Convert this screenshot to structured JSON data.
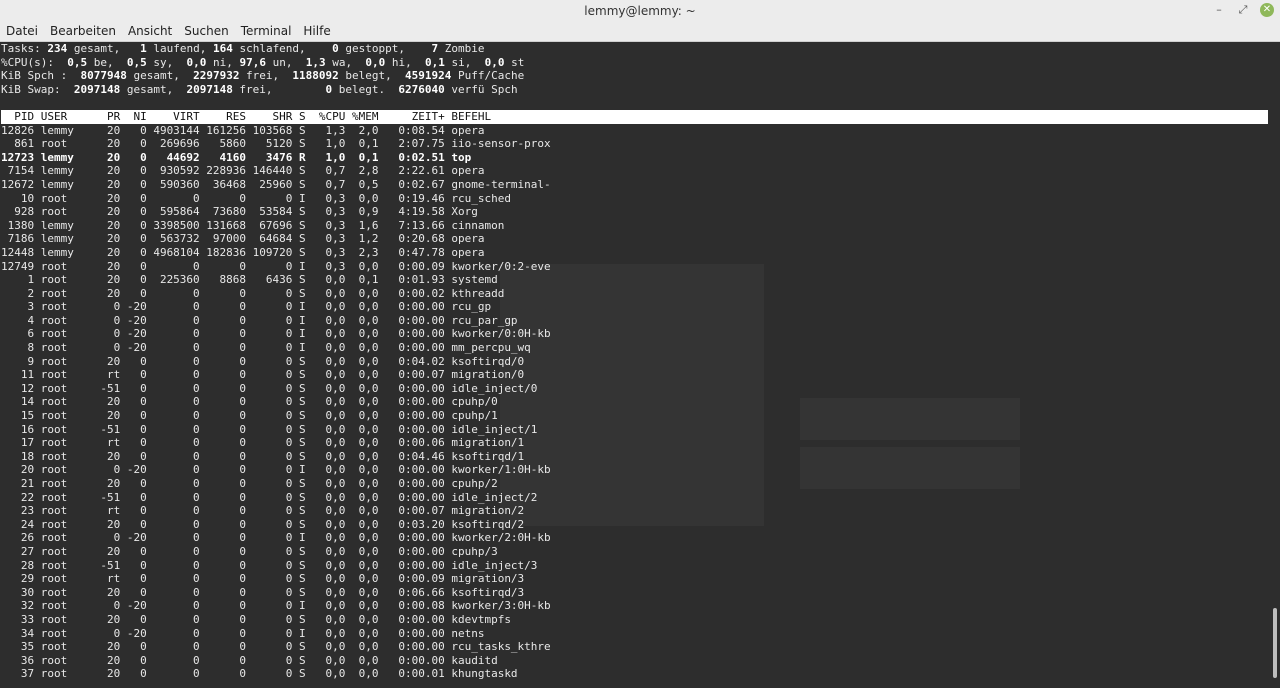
{
  "window": {
    "title": "lemmy@lemmy: ~",
    "controls": [
      "–",
      "⤢",
      "✕"
    ]
  },
  "menu": [
    "Datei",
    "Bearbeiten",
    "Ansicht",
    "Suchen",
    "Terminal",
    "Hilfe"
  ],
  "summary": {
    "tasks": {
      "label": "Tasks:",
      "total": "234",
      "total_label": "gesamt,",
      "running": "1",
      "running_label": "laufend,",
      "sleeping": "164",
      "sleeping_label": "schlafend,",
      "stopped": "0",
      "stopped_label": "gestoppt,",
      "zombie": "7",
      "zombie_label": "Zombie"
    },
    "cpu": {
      "label": "%CPU(s):",
      "be": "0,5",
      "sy": "0,5",
      "ni": "0,0",
      "un": "97,6",
      "wa": "1,3",
      "hi": "0,0",
      "si": "0,1",
      "st": "0,0"
    },
    "mem": {
      "label": "KiB Spch :",
      "total": "8077948",
      "free": "2297932",
      "used": "1188092",
      "cache": "4591924",
      "cache_label": "Puff/Cache"
    },
    "swap": {
      "label": "KiB Swap:",
      "total": "2097148",
      "free": "2097148",
      "used": "0",
      "avail": "6276040",
      "avail_label": "verfü Spch"
    }
  },
  "columns": [
    "PID",
    "USER",
    "PR",
    "NI",
    "VIRT",
    "RES",
    "SHR",
    "S",
    "%CPU",
    "%MEM",
    "ZEIT+",
    "BEFEHL"
  ],
  "processes": [
    [
      "12826",
      "lemmy",
      "20",
      "0",
      "4903144",
      "161256",
      "103568",
      "S",
      "1,3",
      "2,0",
      "0:08.54",
      "opera"
    ],
    [
      "861",
      "root",
      "20",
      "0",
      "269696",
      "5860",
      "5120",
      "S",
      "1,0",
      "0,1",
      "2:07.75",
      "iio-sensor-prox"
    ],
    [
      "12723",
      "lemmy",
      "20",
      "0",
      "44692",
      "4160",
      "3476",
      "R",
      "1,0",
      "0,1",
      "0:02.51",
      "top"
    ],
    [
      "7154",
      "lemmy",
      "20",
      "0",
      "930592",
      "228936",
      "146440",
      "S",
      "0,7",
      "2,8",
      "2:22.61",
      "opera"
    ],
    [
      "12672",
      "lemmy",
      "20",
      "0",
      "590360",
      "36468",
      "25960",
      "S",
      "0,7",
      "0,5",
      "0:02.67",
      "gnome-terminal-"
    ],
    [
      "10",
      "root",
      "20",
      "0",
      "0",
      "0",
      "0",
      "I",
      "0,3",
      "0,0",
      "0:19.46",
      "rcu_sched"
    ],
    [
      "928",
      "root",
      "20",
      "0",
      "595864",
      "73680",
      "53584",
      "S",
      "0,3",
      "0,9",
      "4:19.58",
      "Xorg"
    ],
    [
      "1380",
      "lemmy",
      "20",
      "0",
      "3398500",
      "131668",
      "67696",
      "S",
      "0,3",
      "1,6",
      "7:13.66",
      "cinnamon"
    ],
    [
      "7186",
      "lemmy",
      "20",
      "0",
      "563732",
      "97000",
      "64684",
      "S",
      "0,3",
      "1,2",
      "0:20.68",
      "opera"
    ],
    [
      "12448",
      "lemmy",
      "20",
      "0",
      "4968104",
      "182836",
      "109720",
      "S",
      "0,3",
      "2,3",
      "0:47.78",
      "opera"
    ],
    [
      "12749",
      "root",
      "20",
      "0",
      "0",
      "0",
      "0",
      "I",
      "0,3",
      "0,0",
      "0:00.09",
      "kworker/0:2-eve"
    ],
    [
      "1",
      "root",
      "20",
      "0",
      "225360",
      "8868",
      "6436",
      "S",
      "0,0",
      "0,1",
      "0:01.93",
      "systemd"
    ],
    [
      "2",
      "root",
      "20",
      "0",
      "0",
      "0",
      "0",
      "S",
      "0,0",
      "0,0",
      "0:00.02",
      "kthreadd"
    ],
    [
      "3",
      "root",
      "0",
      "-20",
      "0",
      "0",
      "0",
      "I",
      "0,0",
      "0,0",
      "0:00.00",
      "rcu_gp"
    ],
    [
      "4",
      "root",
      "0",
      "-20",
      "0",
      "0",
      "0",
      "I",
      "0,0",
      "0,0",
      "0:00.00",
      "rcu_par_gp"
    ],
    [
      "6",
      "root",
      "0",
      "-20",
      "0",
      "0",
      "0",
      "I",
      "0,0",
      "0,0",
      "0:00.00",
      "kworker/0:0H-kb"
    ],
    [
      "8",
      "root",
      "0",
      "-20",
      "0",
      "0",
      "0",
      "I",
      "0,0",
      "0,0",
      "0:00.00",
      "mm_percpu_wq"
    ],
    [
      "9",
      "root",
      "20",
      "0",
      "0",
      "0",
      "0",
      "S",
      "0,0",
      "0,0",
      "0:04.02",
      "ksoftirqd/0"
    ],
    [
      "11",
      "root",
      "rt",
      "0",
      "0",
      "0",
      "0",
      "S",
      "0,0",
      "0,0",
      "0:00.07",
      "migration/0"
    ],
    [
      "12",
      "root",
      "-51",
      "0",
      "0",
      "0",
      "0",
      "S",
      "0,0",
      "0,0",
      "0:00.00",
      "idle_inject/0"
    ],
    [
      "14",
      "root",
      "20",
      "0",
      "0",
      "0",
      "0",
      "S",
      "0,0",
      "0,0",
      "0:00.00",
      "cpuhp/0"
    ],
    [
      "15",
      "root",
      "20",
      "0",
      "0",
      "0",
      "0",
      "S",
      "0,0",
      "0,0",
      "0:00.00",
      "cpuhp/1"
    ],
    [
      "16",
      "root",
      "-51",
      "0",
      "0",
      "0",
      "0",
      "S",
      "0,0",
      "0,0",
      "0:00.00",
      "idle_inject/1"
    ],
    [
      "17",
      "root",
      "rt",
      "0",
      "0",
      "0",
      "0",
      "S",
      "0,0",
      "0,0",
      "0:00.06",
      "migration/1"
    ],
    [
      "18",
      "root",
      "20",
      "0",
      "0",
      "0",
      "0",
      "S",
      "0,0",
      "0,0",
      "0:04.46",
      "ksoftirqd/1"
    ],
    [
      "20",
      "root",
      "0",
      "-20",
      "0",
      "0",
      "0",
      "I",
      "0,0",
      "0,0",
      "0:00.00",
      "kworker/1:0H-kb"
    ],
    [
      "21",
      "root",
      "20",
      "0",
      "0",
      "0",
      "0",
      "S",
      "0,0",
      "0,0",
      "0:00.00",
      "cpuhp/2"
    ],
    [
      "22",
      "root",
      "-51",
      "0",
      "0",
      "0",
      "0",
      "S",
      "0,0",
      "0,0",
      "0:00.00",
      "idle_inject/2"
    ],
    [
      "23",
      "root",
      "rt",
      "0",
      "0",
      "0",
      "0",
      "S",
      "0,0",
      "0,0",
      "0:00.07",
      "migration/2"
    ],
    [
      "24",
      "root",
      "20",
      "0",
      "0",
      "0",
      "0",
      "S",
      "0,0",
      "0,0",
      "0:03.20",
      "ksoftirqd/2"
    ],
    [
      "26",
      "root",
      "0",
      "-20",
      "0",
      "0",
      "0",
      "I",
      "0,0",
      "0,0",
      "0:00.00",
      "kworker/2:0H-kb"
    ],
    [
      "27",
      "root",
      "20",
      "0",
      "0",
      "0",
      "0",
      "S",
      "0,0",
      "0,0",
      "0:00.00",
      "cpuhp/3"
    ],
    [
      "28",
      "root",
      "-51",
      "0",
      "0",
      "0",
      "0",
      "S",
      "0,0",
      "0,0",
      "0:00.00",
      "idle_inject/3"
    ],
    [
      "29",
      "root",
      "rt",
      "0",
      "0",
      "0",
      "0",
      "S",
      "0,0",
      "0,0",
      "0:00.09",
      "migration/3"
    ],
    [
      "30",
      "root",
      "20",
      "0",
      "0",
      "0",
      "0",
      "S",
      "0,0",
      "0,0",
      "0:06.66",
      "ksoftirqd/3"
    ],
    [
      "32",
      "root",
      "0",
      "-20",
      "0",
      "0",
      "0",
      "I",
      "0,0",
      "0,0",
      "0:00.08",
      "kworker/3:0H-kb"
    ],
    [
      "33",
      "root",
      "20",
      "0",
      "0",
      "0",
      "0",
      "S",
      "0,0",
      "0,0",
      "0:00.00",
      "kdevtmpfs"
    ],
    [
      "34",
      "root",
      "0",
      "-20",
      "0",
      "0",
      "0",
      "I",
      "0,0",
      "0,0",
      "0:00.00",
      "netns"
    ],
    [
      "35",
      "root",
      "20",
      "0",
      "0",
      "0",
      "0",
      "S",
      "0,0",
      "0,0",
      "0:00.00",
      "rcu_tasks_kthre"
    ],
    [
      "36",
      "root",
      "20",
      "0",
      "0",
      "0",
      "0",
      "S",
      "0,0",
      "0,0",
      "0:00.00",
      "kauditd"
    ],
    [
      "37",
      "root",
      "20",
      "0",
      "0",
      "0",
      "0",
      "S",
      "0,0",
      "0,0",
      "0:00.01",
      "khungtaskd"
    ]
  ],
  "bold_pid": "12723",
  "colors": {
    "terminal_bg": "#2d2d2d",
    "terminal_fg": "#e8e8e8",
    "header_bg": "#ffffff",
    "chrome": "#ececec",
    "close_button": "#8fb85a"
  },
  "icons": {
    "minimize": "minimize-icon",
    "maximize": "maximize-icon",
    "close": "close-icon"
  }
}
